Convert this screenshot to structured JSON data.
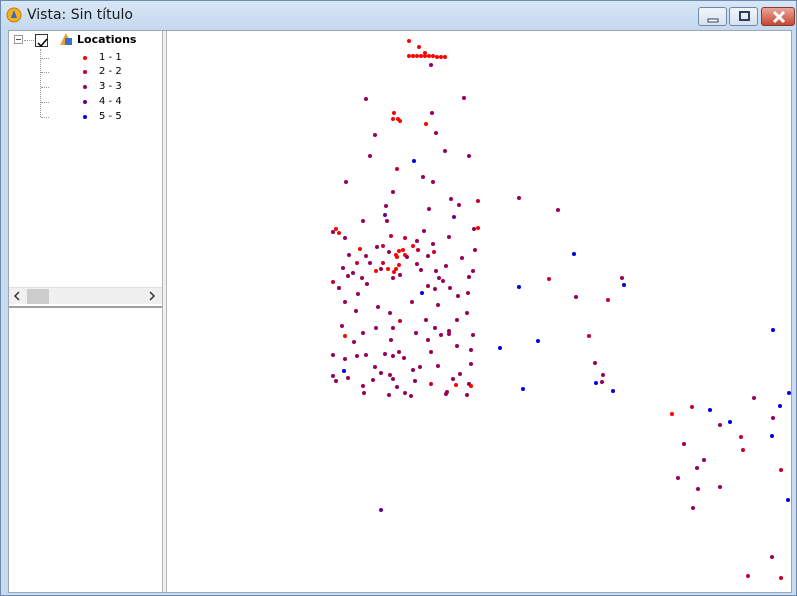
{
  "window": {
    "title": "Vista: Sin título"
  },
  "toc": {
    "layer": {
      "name": "Locations",
      "checked": true
    },
    "legend": [
      {
        "label": "1 - 1",
        "color": "#ff0000"
      },
      {
        "label": "2 - 2",
        "color": "#c8002e"
      },
      {
        "label": "3 - 3",
        "color": "#96005a"
      },
      {
        "label": "4 - 4",
        "color": "#640096"
      },
      {
        "label": "5 - 5",
        "color": "#0000e6"
      }
    ]
  },
  "map": {
    "points": [
      [
        242,
        10,
        1
      ],
      [
        252,
        16,
        1
      ],
      [
        258,
        22,
        1
      ],
      [
        242,
        25,
        1
      ],
      [
        246,
        25,
        1
      ],
      [
        250,
        25,
        1
      ],
      [
        254,
        25,
        1
      ],
      [
        258,
        25,
        1
      ],
      [
        262,
        25,
        1
      ],
      [
        266,
        25,
        1
      ],
      [
        270,
        26,
        1
      ],
      [
        274,
        26,
        1
      ],
      [
        278,
        26,
        1
      ],
      [
        264,
        34,
        3
      ],
      [
        199,
        68,
        3
      ],
      [
        297,
        67,
        3
      ],
      [
        227,
        82,
        1
      ],
      [
        231,
        88,
        1
      ],
      [
        226,
        88,
        1
      ],
      [
        233,
        90,
        1
      ],
      [
        265,
        82,
        3
      ],
      [
        259,
        93,
        1
      ],
      [
        208,
        104,
        3
      ],
      [
        269,
        102,
        3
      ],
      [
        203,
        125,
        3
      ],
      [
        247,
        130,
        5
      ],
      [
        278,
        120,
        3
      ],
      [
        302,
        125,
        3
      ],
      [
        230,
        138,
        2
      ],
      [
        256,
        146,
        3
      ],
      [
        266,
        151,
        3
      ],
      [
        179,
        151,
        3
      ],
      [
        226,
        161,
        3
      ],
      [
        352,
        167,
        3
      ],
      [
        284,
        168,
        3
      ],
      [
        311,
        170,
        2
      ],
      [
        219,
        175,
        3
      ],
      [
        292,
        174,
        3
      ],
      [
        262,
        178,
        3
      ],
      [
        391,
        179,
        3
      ],
      [
        218,
        184,
        4
      ],
      [
        220,
        190,
        3
      ],
      [
        287,
        186,
        4
      ],
      [
        196,
        190,
        3
      ],
      [
        307,
        198,
        3
      ],
      [
        311,
        197,
        1
      ],
      [
        169,
        198,
        1
      ],
      [
        172,
        202,
        1
      ],
      [
        178,
        207,
        3
      ],
      [
        166,
        201,
        3
      ],
      [
        257,
        200,
        3
      ],
      [
        224,
        205,
        2
      ],
      [
        238,
        207,
        2
      ],
      [
        282,
        206,
        3
      ],
      [
        266,
        213,
        3
      ],
      [
        250,
        210,
        3
      ],
      [
        210,
        216,
        3
      ],
      [
        216,
        215,
        2
      ],
      [
        193,
        218,
        1
      ],
      [
        246,
        215,
        1
      ],
      [
        232,
        220,
        1
      ],
      [
        238,
        224,
        1
      ],
      [
        222,
        221,
        3
      ],
      [
        229,
        224,
        1
      ],
      [
        236,
        219,
        1
      ],
      [
        251,
        219,
        2
      ],
      [
        267,
        221,
        2
      ],
      [
        308,
        219,
        3
      ],
      [
        407,
        223,
        5
      ],
      [
        182,
        224,
        3
      ],
      [
        199,
        225,
        3
      ],
      [
        230,
        226,
        1
      ],
      [
        240,
        226,
        3
      ],
      [
        261,
        225,
        3
      ],
      [
        295,
        227,
        3
      ],
      [
        203,
        232,
        3
      ],
      [
        216,
        232,
        2
      ],
      [
        232,
        234,
        1
      ],
      [
        229,
        238,
        1
      ],
      [
        221,
        238,
        1
      ],
      [
        190,
        232,
        2
      ],
      [
        176,
        237,
        3
      ],
      [
        186,
        242,
        3
      ],
      [
        214,
        238,
        3
      ],
      [
        250,
        233,
        3
      ],
      [
        279,
        235,
        3
      ],
      [
        227,
        241,
        1
      ],
      [
        254,
        239,
        3
      ],
      [
        269,
        240,
        3
      ],
      [
        209,
        240,
        1
      ],
      [
        233,
        244,
        3
      ],
      [
        306,
        240,
        3
      ],
      [
        195,
        247,
        3
      ],
      [
        302,
        246,
        3
      ],
      [
        272,
        247,
        3
      ],
      [
        181,
        245,
        3
      ],
      [
        226,
        247,
        3
      ],
      [
        166,
        251,
        2
      ],
      [
        455,
        247,
        3
      ],
      [
        276,
        250,
        3
      ],
      [
        261,
        255,
        3
      ],
      [
        200,
        253,
        3
      ],
      [
        352,
        256,
        5
      ],
      [
        382,
        248,
        2
      ],
      [
        268,
        258,
        3
      ],
      [
        457,
        254,
        5
      ],
      [
        172,
        257,
        3
      ],
      [
        255,
        262,
        5
      ],
      [
        283,
        257,
        3
      ],
      [
        191,
        263,
        3
      ],
      [
        301,
        262,
        3
      ],
      [
        291,
        265,
        3
      ],
      [
        409,
        266,
        3
      ],
      [
        441,
        269,
        2
      ],
      [
        178,
        271,
        3
      ],
      [
        245,
        271,
        3
      ],
      [
        271,
        274,
        3
      ],
      [
        211,
        276,
        3
      ],
      [
        300,
        282,
        3
      ],
      [
        189,
        280,
        3
      ],
      [
        223,
        282,
        3
      ],
      [
        259,
        289,
        3
      ],
      [
        290,
        289,
        3
      ],
      [
        175,
        295,
        3
      ],
      [
        233,
        290,
        2
      ],
      [
        209,
        297,
        3
      ],
      [
        268,
        297,
        3
      ],
      [
        306,
        304,
        3
      ],
      [
        274,
        304,
        3
      ],
      [
        249,
        302,
        3
      ],
      [
        282,
        300,
        3
      ],
      [
        196,
        302,
        3
      ],
      [
        226,
        297,
        3
      ],
      [
        282,
        303,
        3
      ],
      [
        178,
        305,
        1
      ],
      [
        422,
        305,
        2
      ],
      [
        606,
        299,
        5
      ],
      [
        371,
        310,
        5
      ],
      [
        187,
        311,
        3
      ],
      [
        224,
        309,
        3
      ],
      [
        261,
        309,
        3
      ],
      [
        290,
        315,
        3
      ],
      [
        232,
        321,
        3
      ],
      [
        264,
        321,
        3
      ],
      [
        166,
        324,
        3
      ],
      [
        190,
        325,
        3
      ],
      [
        199,
        324,
        3
      ],
      [
        304,
        319,
        3
      ],
      [
        333,
        317,
        5
      ],
      [
        218,
        323,
        3
      ],
      [
        226,
        325,
        3
      ],
      [
        237,
        327,
        3
      ],
      [
        178,
        328,
        3
      ],
      [
        208,
        336,
        3
      ],
      [
        428,
        332,
        3
      ],
      [
        304,
        333,
        3
      ],
      [
        253,
        336,
        3
      ],
      [
        271,
        335,
        3
      ],
      [
        246,
        339,
        3
      ],
      [
        177,
        340,
        5
      ],
      [
        293,
        343,
        3
      ],
      [
        214,
        342,
        3
      ],
      [
        226,
        348,
        3
      ],
      [
        166,
        345,
        3
      ],
      [
        223,
        344,
        3
      ],
      [
        286,
        348,
        3
      ],
      [
        436,
        344,
        3
      ],
      [
        181,
        347,
        3
      ],
      [
        302,
        353,
        3
      ],
      [
        429,
        352,
        5
      ],
      [
        668,
        344,
        1
      ],
      [
        206,
        349,
        3
      ],
      [
        248,
        350,
        3
      ],
      [
        196,
        355,
        3
      ],
      [
        435,
        351,
        3
      ],
      [
        169,
        350,
        3
      ],
      [
        304,
        355,
        1
      ],
      [
        264,
        353,
        2
      ],
      [
        289,
        354,
        1
      ],
      [
        197,
        362,
        3
      ],
      [
        230,
        356,
        3
      ],
      [
        280,
        361,
        3
      ],
      [
        356,
        358,
        5
      ],
      [
        446,
        360,
        5
      ],
      [
        622,
        362,
        5
      ],
      [
        238,
        362,
        3
      ],
      [
        279,
        363,
        3
      ],
      [
        587,
        367,
        3
      ],
      [
        222,
        364,
        3
      ],
      [
        244,
        365,
        3
      ],
      [
        300,
        364,
        3
      ],
      [
        613,
        375,
        5
      ],
      [
        525,
        376,
        2
      ],
      [
        505,
        383,
        1
      ],
      [
        543,
        379,
        5
      ],
      [
        606,
        387,
        3
      ],
      [
        563,
        391,
        5
      ],
      [
        553,
        394,
        3
      ],
      [
        517,
        413,
        3
      ],
      [
        574,
        406,
        2
      ],
      [
        605,
        405,
        5
      ],
      [
        576,
        419,
        2
      ],
      [
        537,
        429,
        3
      ],
      [
        530,
        437,
        3
      ],
      [
        614,
        439,
        2
      ],
      [
        511,
        447,
        3
      ],
      [
        553,
        456,
        3
      ],
      [
        531,
        458,
        3
      ],
      [
        621,
        469,
        5
      ],
      [
        526,
        477,
        3
      ],
      [
        214,
        479,
        4
      ],
      [
        605,
        526,
        3
      ],
      [
        581,
        545,
        2
      ],
      [
        614,
        547,
        2
      ]
    ]
  }
}
